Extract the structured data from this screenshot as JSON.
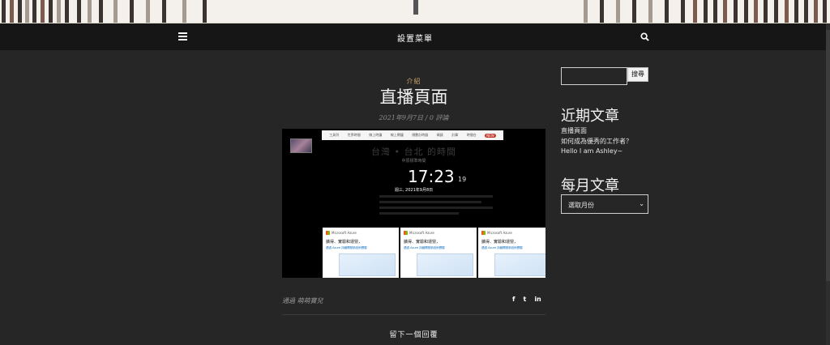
{
  "nav": {
    "title": "設置菜單"
  },
  "post": {
    "category": "介紹",
    "title": "直播頁面",
    "meta": "2021年9月7日 / 0 評論",
    "byline": "通過 萌萌寶兒",
    "share": {
      "facebook": "f",
      "twitter": "t",
      "linkedin": "in"
    },
    "reply_title": "留下一個回覆"
  },
  "embedded": {
    "nav_items": [
      "工具列",
      "世界時間",
      "線上時鐘",
      "線上鬧鐘",
      "倒數計時器",
      "碼錶",
      "計算",
      "時間台"
    ],
    "nav_badge": "NEW",
    "clock_title": "台灣 • 台北 的時間",
    "clock_sub": "中原標準時間",
    "clock_time": "17:23",
    "clock_seconds": "19",
    "clock_date": "週三, 2021年9月8日",
    "ads": [
      {
        "brand": "Microsoft Azure",
        "headline": "擴得、實驗和運營，",
        "sub": "透過 Azure 持續開發新技術實驗"
      },
      {
        "brand": "Microsoft Azure",
        "headline": "擴得、實驗和運營，",
        "sub": "透過 Azure 持續開發新技術實驗"
      },
      {
        "brand": "Microsoft Azure",
        "headline": "擴得、實驗和運營，",
        "sub": "透過 Azure 持續開發新技術實驗"
      }
    ]
  },
  "sidebar": {
    "search_button": "搜尋",
    "recent_title": "近期文章",
    "recent": [
      "直播頁面",
      "如何成為優秀的工作者？",
      "Hello I am Ashley~"
    ],
    "archive_title": "每月文章",
    "archive_select": "選取月份"
  }
}
